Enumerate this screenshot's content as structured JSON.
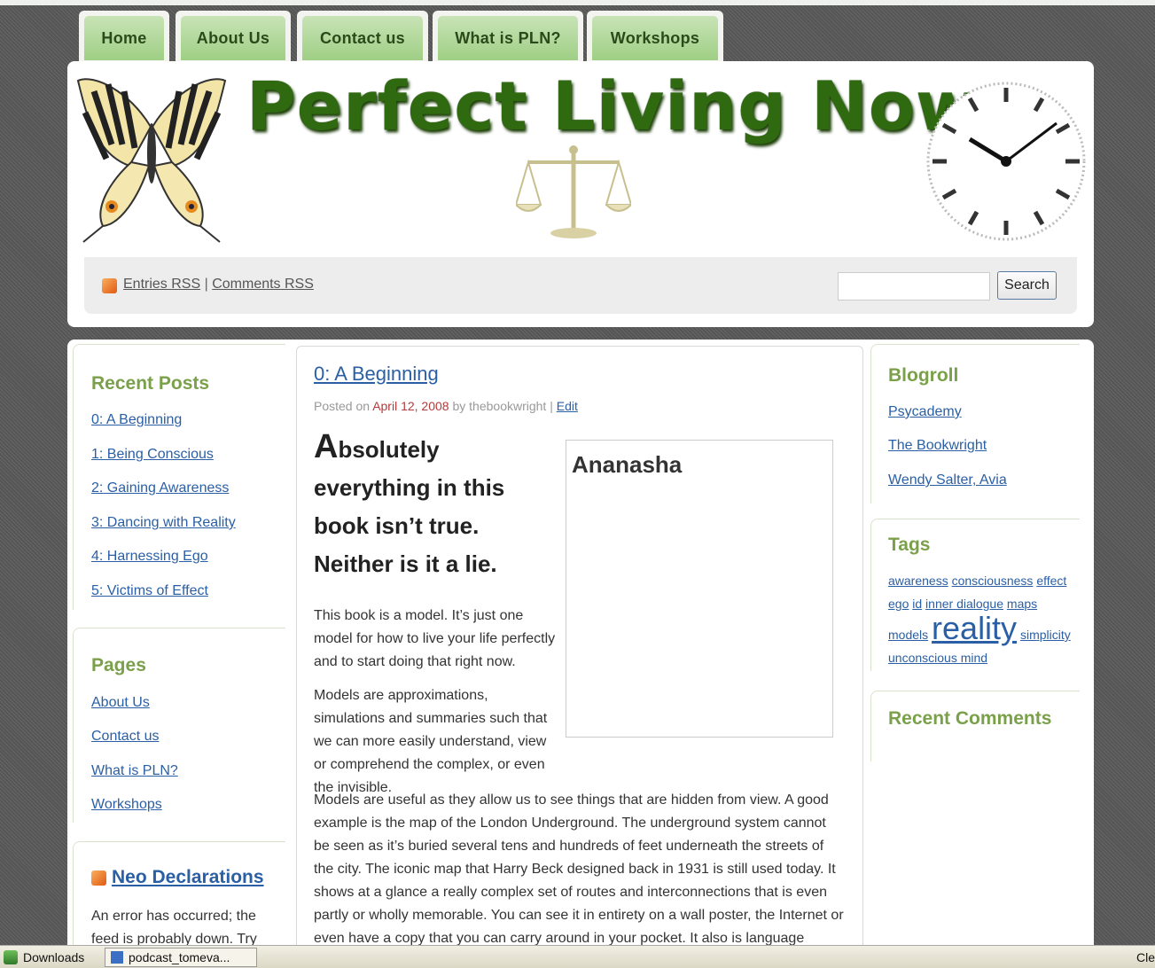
{
  "nav": {
    "tabs": [
      "Home",
      "About Us",
      "Contact us",
      "What is PLN?",
      "Workshops"
    ]
  },
  "header": {
    "site_title": "Perfect Living Now",
    "rss": {
      "entries": "Entries RSS",
      "separator": "|",
      "comments": "Comments RSS"
    },
    "search": {
      "value": "",
      "button": "Search"
    }
  },
  "sidebar_left": {
    "recent_posts": {
      "title": "Recent Posts",
      "items": [
        "0: A Beginning",
        "1: Being Conscious",
        "2: Gaining Awareness",
        "3: Dancing with Reality",
        "4: Harnessing Ego",
        "5: Victims of Effect"
      ]
    },
    "pages": {
      "title": "Pages",
      "items": [
        "About Us",
        "Contact us",
        "What is PLN?",
        "Workshops"
      ]
    },
    "feed": {
      "title": "Neo Declarations",
      "text": "An error has occurred; the feed is probably down. Try"
    }
  },
  "post": {
    "title": "0: A Beginning",
    "meta": {
      "posted_on": "Posted on",
      "date": "April 12, 2008",
      "by": "by thebookwright",
      "sep": "|",
      "edit": "Edit"
    },
    "lead_first_letter": "A",
    "lead_rest": "bsolutely everything in this book isn’t true. Neither is it a lie.",
    "image_caption": "Ananasha",
    "p1": "This book is a model. It’s just one model for how to live your life perfectly and to start doing that right now.",
    "p2": "Models are approximations, simulations and summaries such that we can more easily understand, view or comprehend the complex, or even the invisible.",
    "p3": "Models are useful as they allow us to see things that are hidden from view. A good example is the map of the London Underground. The underground system cannot be seen as it’s buried several tens and hundreds of feet underneath the streets of the city. The iconic map that Harry Beck designed back in 1931 is still used today. It shows at a glance a really complex set of routes and interconnections that is even partly or wholly memorable. You can see it in entirety on a wall poster, the Internet or even have a copy that you can carry around in your pocket. It also is language"
  },
  "sidebar_right": {
    "blogroll": {
      "title": "Blogroll",
      "items": [
        "Psycademy",
        "The Bookwright",
        "Wendy Salter, Avia"
      ]
    },
    "tags": {
      "title": "Tags",
      "items": [
        "awareness",
        "consciousness",
        "effect",
        "ego",
        "id",
        "inner dialogue",
        "maps",
        "models",
        "reality",
        "simplicity",
        "unconscious mind"
      ]
    },
    "recent_comments": {
      "title": "Recent Comments"
    }
  },
  "taskbar": {
    "downloads": "Downloads",
    "item": "podcast_tomeva...",
    "right": "Cle"
  },
  "colors": {
    "tab_green": "#9fcf85",
    "title_green": "#2f6a10",
    "sidebar_heading": "#7aa04a",
    "link": "#2a5fa5",
    "date": "#b23a3a"
  }
}
